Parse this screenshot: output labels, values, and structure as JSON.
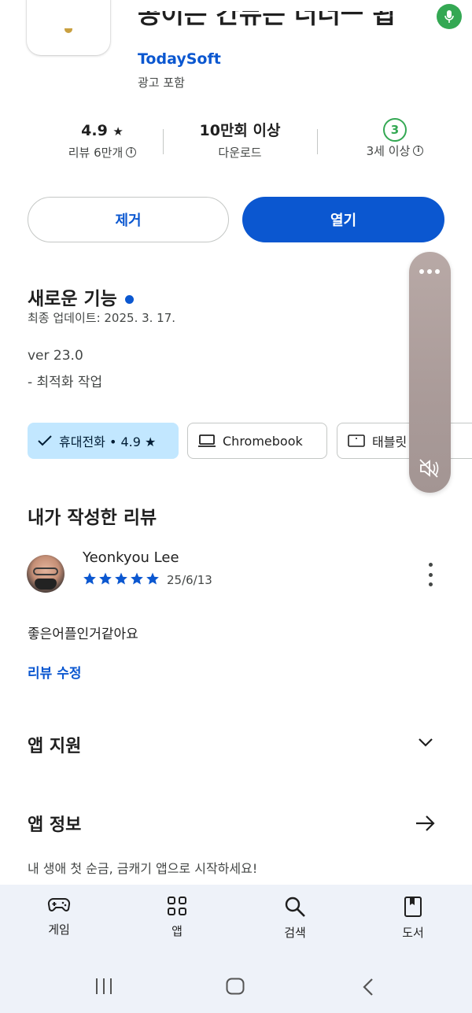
{
  "app": {
    "title": "공이는 간뉴는 너너ㅡ 됩",
    "developer": "TodaySoft",
    "ads_note": "광고 포함"
  },
  "stats": {
    "rating": {
      "value": "4.9",
      "label": "리뷰 6만개"
    },
    "downloads": {
      "value": "10만회 이상",
      "label": "다운로드"
    },
    "age": {
      "value": "3",
      "label": "3세 이상"
    }
  },
  "actions": {
    "uninstall": "제거",
    "open": "열기"
  },
  "whats_new": {
    "title": "새로운 기능",
    "updated": "최종 업데이트: 2025. 3. 17.",
    "version": "ver 23.0",
    "note": "- 최적화 작업"
  },
  "devices": {
    "phone": "휴대전화 • 4.9 ★",
    "chromebook": "Chromebook",
    "tablet": "태블릿"
  },
  "my_review": {
    "title": "내가 작성한 리뷰",
    "reviewer": "Yeonkyou Lee",
    "stars": 5,
    "date": "25/6/13",
    "text": "좋은어플인거같아요",
    "edit": "리뷰 수정"
  },
  "app_support": {
    "title": "앱 지원"
  },
  "app_info": {
    "title": "앱 정보",
    "description": "내 생애 첫 순금, 금캐기 앱으로 시작하세요!"
  },
  "bottom_nav": {
    "items": [
      {
        "label": "게임",
        "icon": "gamepad-icon"
      },
      {
        "label": "앱",
        "icon": "apps-grid-icon"
      },
      {
        "label": "검색",
        "icon": "search-icon"
      },
      {
        "label": "도서",
        "icon": "book-icon"
      }
    ]
  },
  "colors": {
    "accent": "#0b57d0",
    "chip_selected": "#c2e7ff",
    "age_green": "#34a853",
    "nav_bg": "#eef2f9"
  }
}
